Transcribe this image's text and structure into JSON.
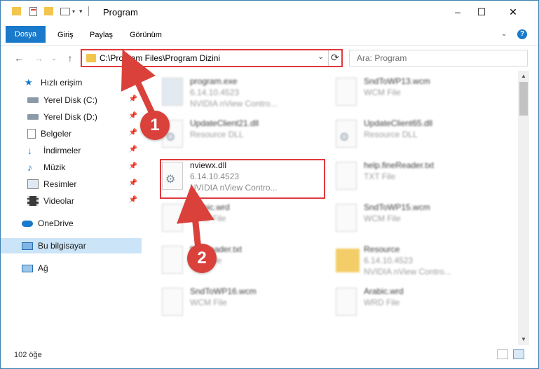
{
  "window": {
    "title": "Program",
    "controls": {
      "minimize": "–",
      "maximize": "☐",
      "close": "✕"
    }
  },
  "ribbon": {
    "tabs": [
      "Dosya",
      "Giriş",
      "Paylaş",
      "Görünüm"
    ],
    "file_tab_color": "#1979ca"
  },
  "nav": {
    "back": "←",
    "forward": "→",
    "up": "↑",
    "address": "C:\\Program Files\\Program Dizini",
    "search_placeholder": "Ara: Program",
    "dropdown": "⌄",
    "refresh": "⟳"
  },
  "sidebar": {
    "items": [
      {
        "label": "Hızlı erişim",
        "icon": "star-icon"
      },
      {
        "label": "Yerel Disk (C:)",
        "icon": "drive-icon",
        "pinned": true
      },
      {
        "label": "Yerel Disk (D:)",
        "icon": "drive-icon",
        "pinned": true
      },
      {
        "label": "Belgeler",
        "icon": "document-icon",
        "pinned": true
      },
      {
        "label": "İndirmeler",
        "icon": "download-icon",
        "pinned": true
      },
      {
        "label": "Müzik",
        "icon": "music-icon",
        "pinned": true
      },
      {
        "label": "Resimler",
        "icon": "picture-icon",
        "pinned": true
      },
      {
        "label": "Videolar",
        "icon": "film-icon",
        "pinned": true
      },
      {
        "label": "OneDrive",
        "icon": "cloud-icon"
      },
      {
        "label": "Bu bilgisayar",
        "icon": "computer-icon",
        "selected": true
      },
      {
        "label": "Ağ",
        "icon": "network-icon"
      }
    ]
  },
  "files": {
    "left": [
      {
        "name": "program.exe",
        "line2": "6.14.10.4523",
        "line3": "NVIDIA nView Contro...",
        "icon": "exe-icon"
      },
      {
        "name": "UpdateClient21.dll",
        "line2": "Resource DLL",
        "line3": "",
        "icon": "dll-icon"
      },
      {
        "name": "nviewx.dll",
        "line2": "6.14.10.4523",
        "line3": "NVIDIA nView Contro...",
        "icon": "dll-icon"
      },
      {
        "name": "Arabic.wrd",
        "line2": "WRD File",
        "line3": "",
        "icon": "file-icon"
      },
      {
        "name": "fineReader.txt",
        "line2": "TXT File",
        "line3": "",
        "icon": "file-icon"
      },
      {
        "name": "SndToWP16.wcm",
        "line2": "WCM File",
        "line3": "",
        "icon": "file-icon"
      }
    ],
    "right": [
      {
        "name": "SndToWP13.wcm",
        "line2": "WCM File",
        "line3": "",
        "icon": "file-icon"
      },
      {
        "name": "UpdateClient65.dll",
        "line2": "Resource DLL",
        "line3": "",
        "icon": "dll-icon"
      },
      {
        "name": "help.fineReader.txt",
        "line2": "TXT File",
        "line3": "",
        "icon": "file-icon"
      },
      {
        "name": "SndToWP15.wcm",
        "line2": "WCM File",
        "line3": "",
        "icon": "file-icon"
      },
      {
        "name": "Resource",
        "line2": "6.14.10.4523",
        "line3": "NVIDIA nView Contro...",
        "icon": "folder-icon"
      },
      {
        "name": "Arabic.wrd",
        "line2": "WRD File",
        "line3": "",
        "icon": "file-icon"
      }
    ]
  },
  "status": {
    "count": "102 öğe"
  },
  "callouts": {
    "one": "1",
    "two": "2",
    "color": "#d9413a"
  }
}
